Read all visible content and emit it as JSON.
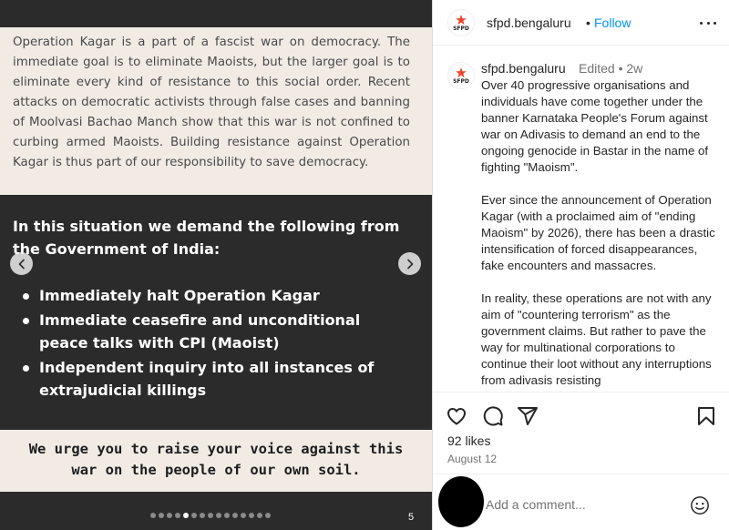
{
  "post_image": {
    "intro_paragraph": " Operation Kagar is a part of a fascist war on democracy. The immediate goal is to eliminate Maoists, but the larger goal is to eliminate every kind of resistance to this social order. Recent attacks on democratic activists through false cases and banning of Moolvasi Bachao Manch show that this war is not confined to curbing armed Maoists. Building resistance against Operation Kagar is thus part of our responsibility to save democracy.",
    "demand_heading": "In this situation we demand the following from the Government of India:",
    "demands": [
      "Immediately halt Operation Kagar",
      "Immediate ceasefire and unconditional peace talks with CPI (Maoist)",
      "Independent inquiry into all instances of extrajudicial killings"
    ],
    "closing": "We urge you to raise your voice against this war on the people of our own soil.",
    "page_number": "5",
    "dot_count": 15,
    "active_dot": 4
  },
  "header": {
    "logo_text": "SFPD",
    "username": "sfpd.bengaluru",
    "separator": "•",
    "follow_label": "Follow",
    "more_icon": "more-horizontal-icon"
  },
  "caption": {
    "username": "sfpd.bengaluru",
    "meta": "Edited  •  2w",
    "paragraphs": [
      "Over 40 progressive organisations and individuals have come together under the banner Karnataka People's Forum against war on Adivasis to demand an end to the ongoing genocide in Bastar in the name of fighting \"Maoism\".",
      "Ever since the announcement of Operation Kagar (with a proclaimed aim of \"ending Maoism\" by 2026), there has been a drastic intensification of forced disappearances, fake encounters and massacres.",
      "In reality, these operations are not with any aim of \"countering terrorism\" as the government claims. But rather to pave the way for multinational corporations to continue their loot without any interruptions from adivasis resisting"
    ]
  },
  "actions": {
    "icons": [
      "heart-icon",
      "comment-icon",
      "share-icon",
      "bookmark-icon"
    ]
  },
  "likes": "92 likes",
  "date": "August 12",
  "comment": {
    "placeholder": "Add a comment...",
    "emoji_icon": "emoji-icon"
  },
  "colors": {
    "dark_bg": "#2b2b2b",
    "beige_bg": "#f1ebe4",
    "link_blue": "#0095f6",
    "logo_red": "#e8462b"
  }
}
